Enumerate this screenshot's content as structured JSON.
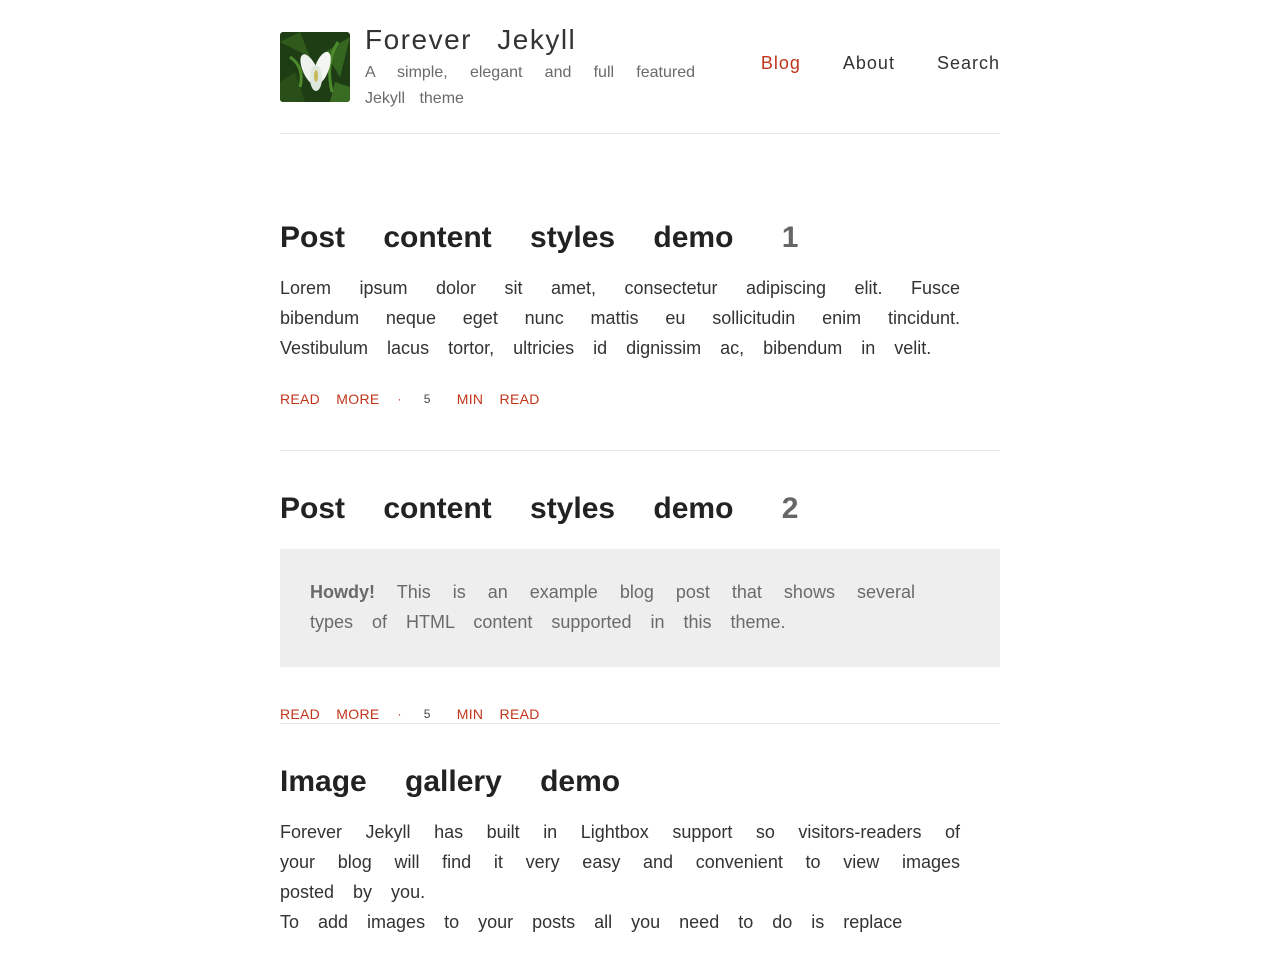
{
  "header": {
    "site_title": "Forever Jekyll",
    "site_description": "A simple, elegant and full featured Jekyll theme",
    "logo_icon": "white-lily-flower-logo",
    "nav": [
      {
        "label": "Blog",
        "active": true
      },
      {
        "label": "About",
        "active": false
      },
      {
        "label": "Search",
        "active": false
      }
    ]
  },
  "colors": {
    "accent": "#c0361b",
    "text": "#222222",
    "muted": "#6a6a6a",
    "callout_bg": "#eeeeee"
  },
  "posts": [
    {
      "title": "Post content styles demo",
      "number": "1",
      "excerpt": "Lorem ipsum dolor sit amet, consectetur adipiscing elit. Fusce bibendum neque eget nunc mattis eu sollicitudin enim tincidunt. Vestibulum lacus tortor, ultricies id dignissim ac, bibendum in velit.",
      "read_more": "Read more",
      "separator": "·",
      "read_minutes": "5",
      "read_label": "min read"
    },
    {
      "title": "Post content styles demo",
      "number": "2",
      "callout_bold": "Howdy!",
      "callout_text": "This is an example blog post that shows several types of HTML content supported in this theme.",
      "read_more": "Read more",
      "separator": "·",
      "read_minutes": "5",
      "read_label": "min read"
    },
    {
      "title": "Image gallery demo",
      "excerpt_line1": "Forever Jekyll has built in Lightbox support so visitors-readers of your blog will find it very easy and convenient to view images posted by you.",
      "excerpt_line2": "To add images to your posts all you need to do is replace"
    }
  ]
}
